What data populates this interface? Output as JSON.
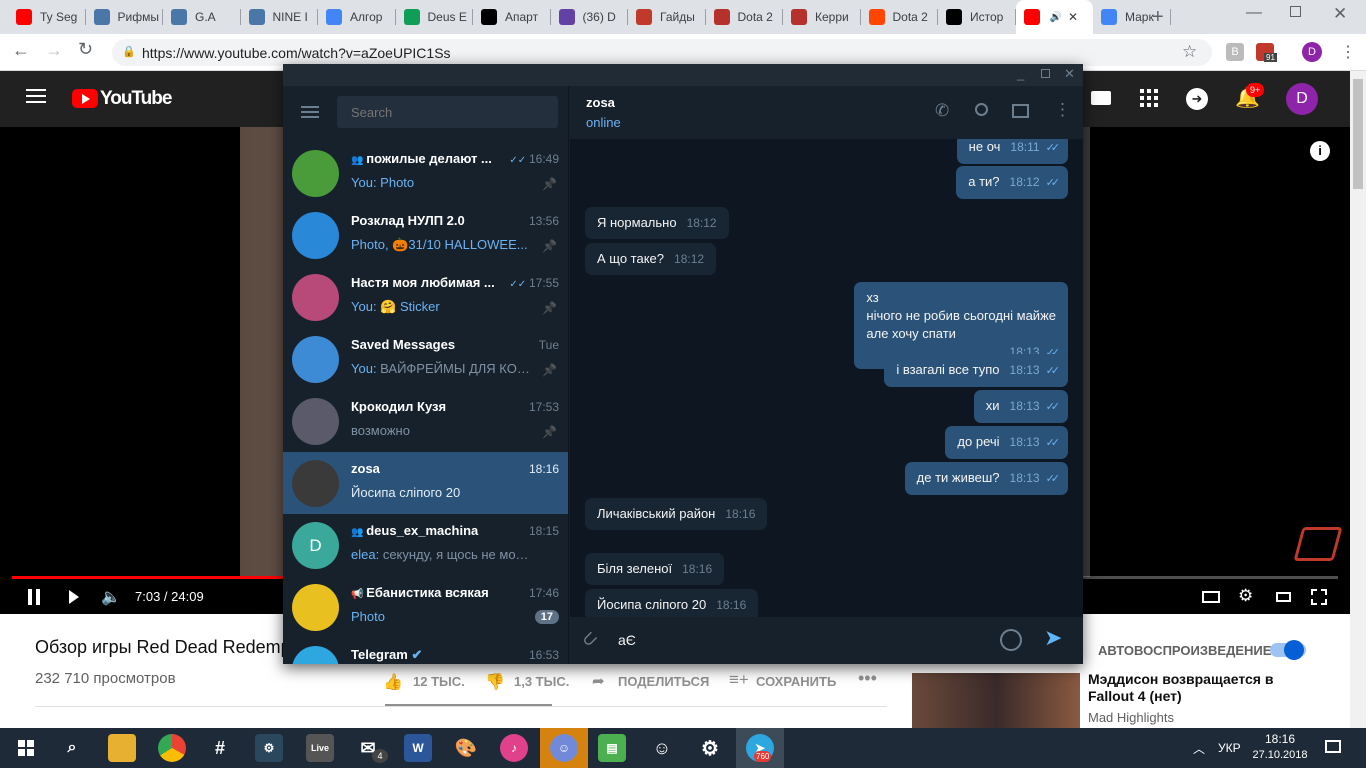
{
  "browser": {
    "tabs": [
      {
        "label": "Ty Seg",
        "icon": "youtube-icon",
        "color": "#ff0000"
      },
      {
        "label": "Рифмы",
        "icon": "vk-icon",
        "color": "#4a76a8"
      },
      {
        "label": "G.A",
        "icon": "vk-icon",
        "color": "#4a76a8"
      },
      {
        "label": "NINE I",
        "icon": "vk-icon",
        "color": "#4a76a8"
      },
      {
        "label": "Алгор",
        "icon": "docs-icon",
        "color": "#4285f4"
      },
      {
        "label": "Deus E",
        "icon": "drive-icon",
        "color": "#0f9d58"
      },
      {
        "label": "Апарт",
        "icon": "wikipedia-icon",
        "color": "#000000"
      },
      {
        "label": "(36) D",
        "icon": "twitch-icon",
        "color": "#6441a5"
      },
      {
        "label": "Гайды",
        "icon": "guide-icon",
        "color": "#c0392b"
      },
      {
        "label": "Dota 2",
        "icon": "dota-icon",
        "color": "#b7312c"
      },
      {
        "label": "Керри",
        "icon": "dota-icon",
        "color": "#b7312c"
      },
      {
        "label": "Dota 2",
        "icon": "reddit-icon",
        "color": "#ff4500"
      },
      {
        "label": "Истор",
        "icon": "wikipedia-icon",
        "color": "#000000"
      },
      {
        "label": "",
        "icon": "youtube-icon",
        "color": "#ff0000",
        "active": true
      },
      {
        "label": "Марк",
        "icon": "google-icon",
        "color": "#4285f4"
      }
    ],
    "url": "https://www.youtube.com/watch?v=aZoeUPIC1Ss",
    "ext_badge": "91",
    "profile": "D"
  },
  "youtube": {
    "logo": "YouTube",
    "notif_count": "9+",
    "avatar": "D",
    "time": "7:03 / 24:09",
    "title": "Обзор игры Red Dead Redemp",
    "views": "232 710 просмотров",
    "likes": "12 ТЫС.",
    "dislikes": "1,3 ТЫС.",
    "share": "ПОДЕЛИТЬСЯ",
    "save": "СОХРАНИТЬ",
    "autoplay": "АВТОВОСПРОИЗВЕДЕНИЕ",
    "rec_title": "Мэддисон возвращается в Fallout 4 (нет)",
    "rec_channel": "Mad Highlights",
    "progress": 0.29
  },
  "telegram": {
    "search_placeholder": "Search",
    "chats": [
      {
        "name": "пожилые делают ...",
        "time": "16:49",
        "preview": "Photo",
        "you": "You: ",
        "group": true,
        "read": true,
        "pinned": true,
        "color": "#4a9b3a",
        "initial": ""
      },
      {
        "name": "Розклад НУЛП 2.0",
        "time": "13:56",
        "preview": "Photo, 🎃31/10 HALLOWEE...",
        "you": "",
        "pinned": true,
        "color": "#2a88d8",
        "initial": ""
      },
      {
        "name": "Настя моя любимая ...",
        "time": "17:55",
        "preview": "🤗 Sticker",
        "you": "You: ",
        "read": true,
        "pinned": true,
        "color": "#b84a7a",
        "initial": ""
      },
      {
        "name": "Saved Messages",
        "time": "Tue",
        "preview": "ВАЙФРЕЙМЫ ДЛЯ КОН...",
        "you": "You: ",
        "pinned": true,
        "color": "#3d8ad5",
        "initial": ""
      },
      {
        "name": "Крокодил Кузя",
        "time": "17:53",
        "preview": "возможно",
        "you": "",
        "pinned": true,
        "color": "#5a5a6a",
        "initial": ""
      },
      {
        "name": "zosa",
        "time": "18:16",
        "preview": "Йосипа сліпого 20",
        "you": "",
        "selected": true,
        "color": "#3a3a3a",
        "initial": ""
      },
      {
        "name": "deus_ex_machina",
        "time": "18:15",
        "preview": "секунду, я щось не можу у...",
        "you": "elea: ",
        "group": true,
        "color": "#3aa89a",
        "initial": "D"
      },
      {
        "name": "Ебанистика всякая",
        "time": "17:46",
        "preview": "Photo",
        "you": "",
        "channel": true,
        "badge": "17",
        "color": "#e8c020",
        "initial": ""
      },
      {
        "name": "Telegram",
        "time": "16:53",
        "preview": "",
        "you": "",
        "verified": true,
        "color": "#2ea6e0",
        "initial": ""
      }
    ],
    "peer": {
      "name": "zosa",
      "status": "online"
    },
    "messages": [
      {
        "text": "не оч",
        "time": "18:11",
        "out": true
      },
      {
        "text": "а ти?",
        "time": "18:12",
        "out": true
      },
      {
        "text": "Я нормально",
        "time": "18:12",
        "out": false
      },
      {
        "text": "А що таке?",
        "time": "18:12",
        "out": false
      },
      {
        "lines": [
          "хз",
          "нічого не робив сьогодні майже",
          "але хочу спати"
        ],
        "time": "18:13",
        "out": true
      },
      {
        "text": "і взагалі все тупо",
        "time": "18:13",
        "out": true
      },
      {
        "text": "хи",
        "time": "18:13",
        "out": true
      },
      {
        "text": "до речі",
        "time": "18:13",
        "out": true
      },
      {
        "text": "де ти живеш?",
        "time": "18:13",
        "out": true
      },
      {
        "text": "Личаківський район",
        "time": "18:16",
        "out": false
      },
      {
        "text": "Біля зеленої",
        "time": "18:16",
        "out": false
      },
      {
        "text": "Йосипа сліпого 20",
        "time": "18:16",
        "out": false
      }
    ],
    "input_value": "аЄ"
  },
  "taskbar": {
    "lang": "УКР",
    "time": "18:16",
    "date": "27.10.2018",
    "mail_badge": "4",
    "tg_badge": "760"
  }
}
